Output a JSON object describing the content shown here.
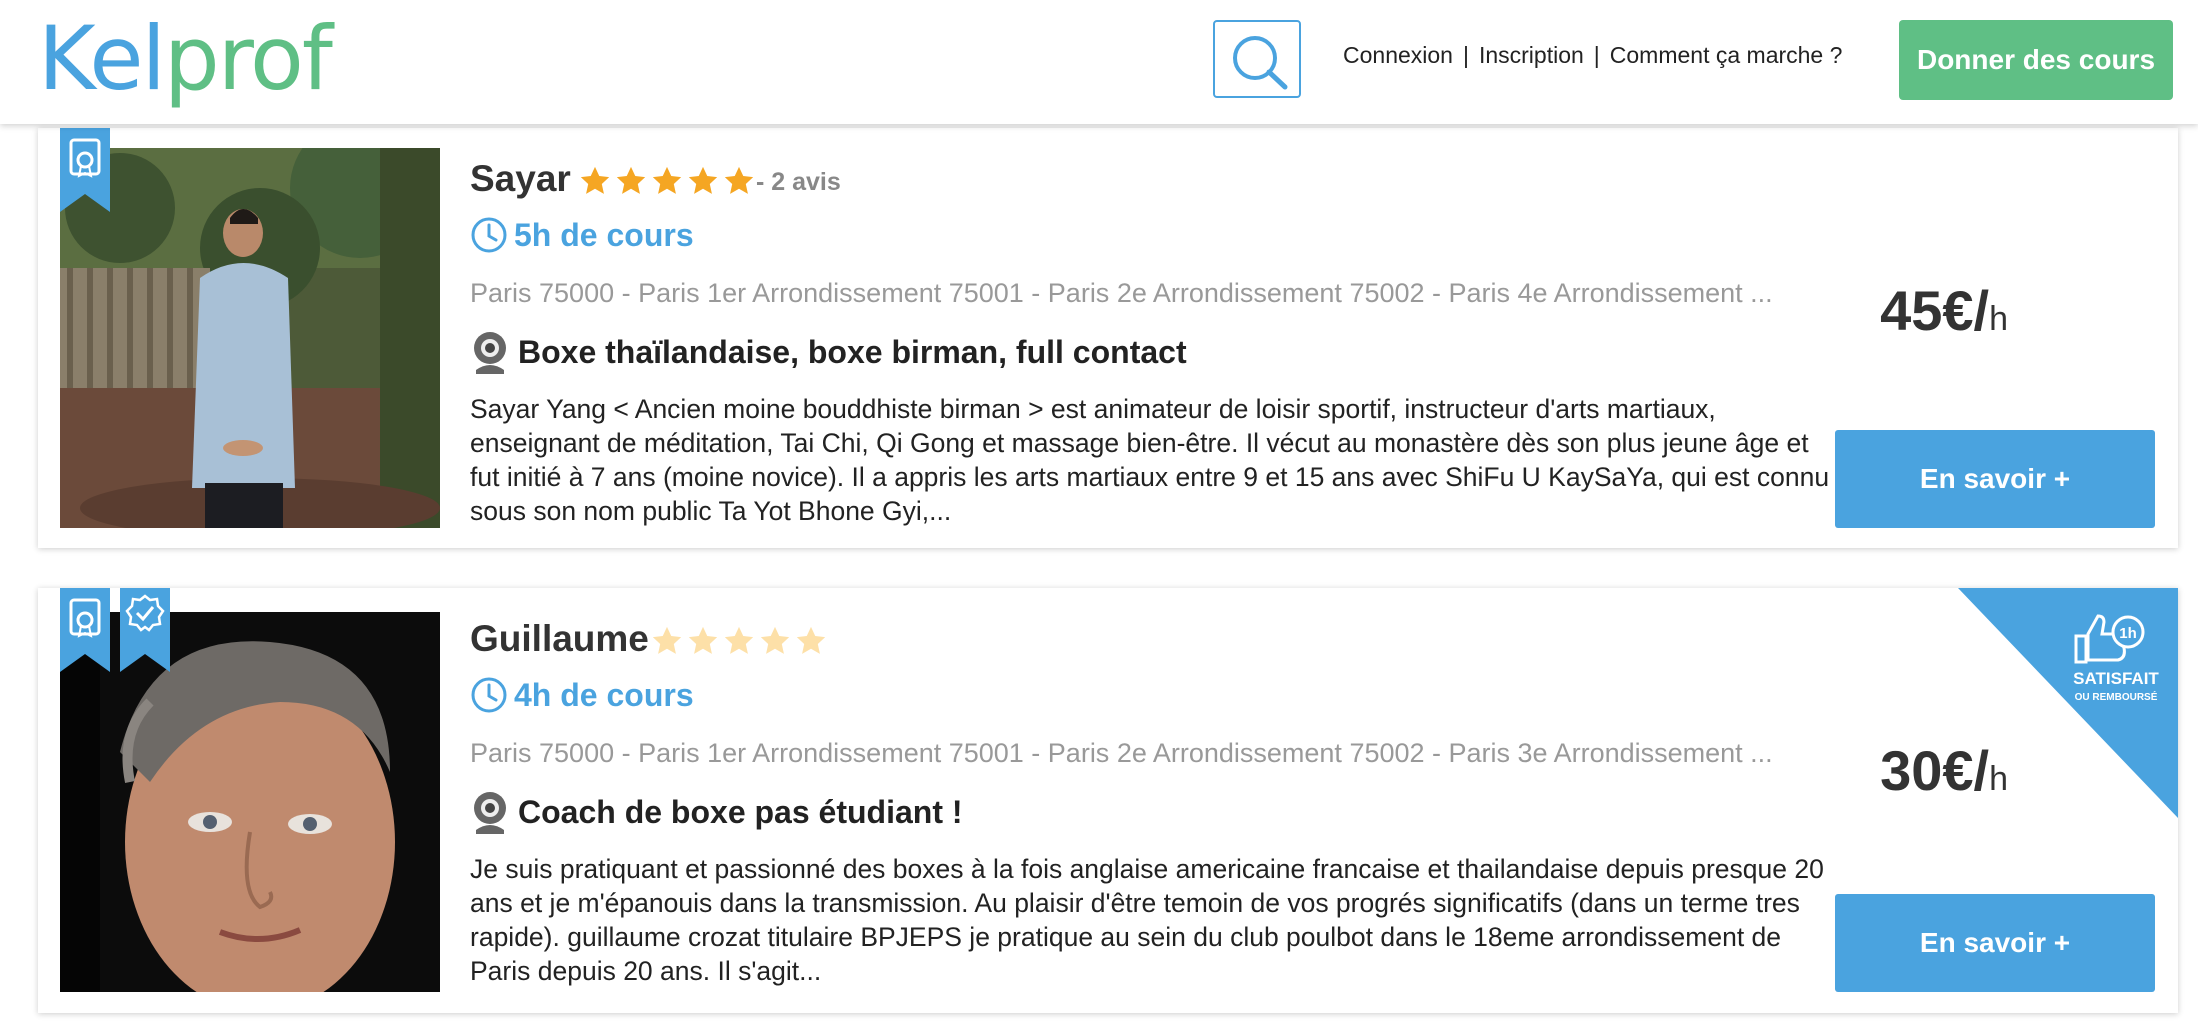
{
  "header": {
    "logo_part1": "Kel",
    "logo_part2": "prof",
    "nav": {
      "login": "Connexion",
      "signup": "Inscription",
      "how": "Comment ça marche ?",
      "separator": "|"
    },
    "cta": "Donner des cours"
  },
  "teachers": [
    {
      "name": "Sayar",
      "rating": 5,
      "reviews": "- 2 avis",
      "hours": "5h de cours",
      "locations": "Paris 75000 - Paris 1er Arrondissement 75001 - Paris 2e Arrondissement 75002 - Paris 4e Arrondissement ...",
      "title": "Boxe thaïlandaise, boxe birman, full contact",
      "description": "Sayar Yang < Ancien moine bouddhiste birman > est animateur de loisir sportif, instructeur d'arts martiaux, enseignant de méditation, Tai Chi, Qi Gong et massage bien-être. Il vécut au monastère dès son plus jeune âge et fut initié à 7 ans (moine novice). Il a appris les arts martiaux entre 9 et 15 ans avec ShiFu U KaySaYa, qui est connu sous son nom public Ta Yot Bhone Gyi,...",
      "price": "45€/",
      "price_unit": "h",
      "button": "En savoir +"
    },
    {
      "name": "Guillaume",
      "rating": 0,
      "hours": "4h de cours",
      "locations": "Paris 75000 - Paris 1er Arrondissement 75001 - Paris 2e Arrondissement 75002 - Paris 3e Arrondissement ...",
      "title": "Coach de boxe pas étudiant !",
      "description": "Je suis pratiquant et passionné des boxes à la fois anglaise americaine francaise et thailandaise depuis presque 20 ans et je m'épanouis dans la transmission. Au plaisir d'être temoin de vos progrés significatifs (dans un terme tres rapide). guillaume crozat titulaire BPJEPS je pratique au sein du club poulbot dans le 18eme arrondissement de Paris depuis 20 ans. Il s'agit...",
      "price": "30€/",
      "price_unit": "h",
      "button": "En savoir +",
      "badge_line1": "SATISFAIT",
      "badge_line2": "OU REMBOURSÉ",
      "badge_hours": "1h"
    }
  ],
  "colors": {
    "blue": "#4aa3df",
    "green": "#5fbf85",
    "star": "#f5a623",
    "star_empty": "#fde0a8"
  },
  "icons": [
    "search-icon",
    "clock-icon",
    "webcam-icon",
    "certificate-icon",
    "verified-icon",
    "thumbs-up-icon",
    "star-icon"
  ]
}
